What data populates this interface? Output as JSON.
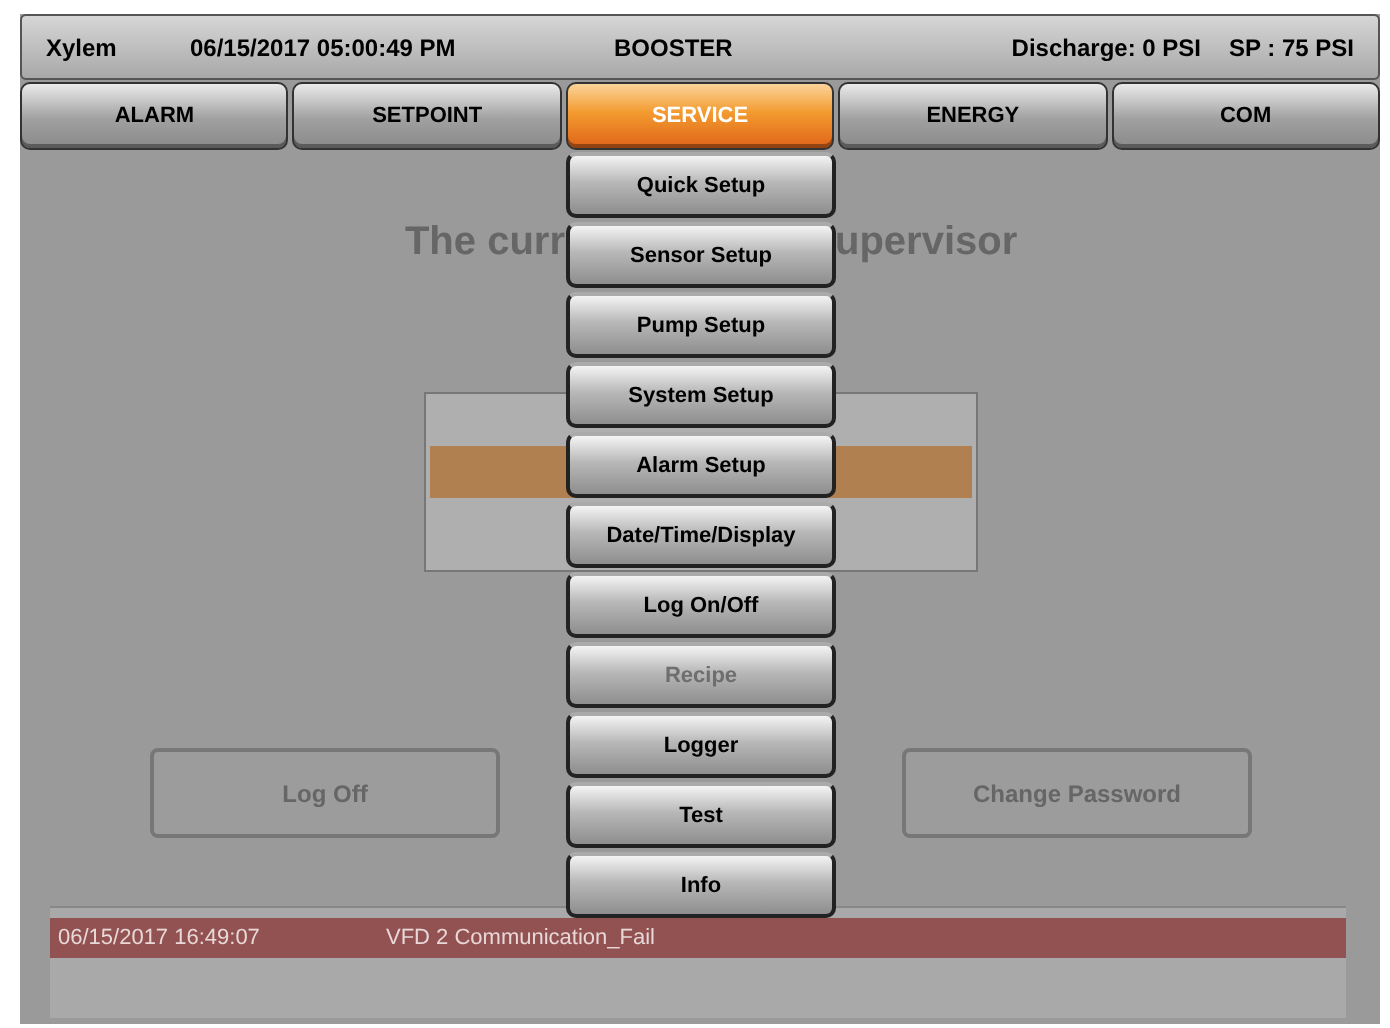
{
  "header": {
    "brand": "Xylem",
    "datetime": "06/15/2017 05:00:49 PM",
    "title": "BOOSTER",
    "discharge": "Discharge: 0 PSI",
    "setpoint": "SP : 75 PSI"
  },
  "tabs": [
    {
      "label": "ALARM",
      "selected": false
    },
    {
      "label": "SETPOINT",
      "selected": false
    },
    {
      "label": "SERVICE",
      "selected": true
    },
    {
      "label": "ENERGY",
      "selected": false
    },
    {
      "label": "COM",
      "selected": false
    }
  ],
  "heading": {
    "left": "The curr",
    "right": "upervisor"
  },
  "menu": [
    {
      "label": "Quick Setup",
      "disabled": false
    },
    {
      "label": "Sensor Setup",
      "disabled": false
    },
    {
      "label": "Pump Setup",
      "disabled": false
    },
    {
      "label": "System Setup",
      "disabled": false
    },
    {
      "label": "Alarm Setup",
      "disabled": false
    },
    {
      "label": "Date/Time/Display",
      "disabled": false
    },
    {
      "label": "Log On/Off",
      "disabled": false
    },
    {
      "label": "Recipe",
      "disabled": true
    },
    {
      "label": "Logger",
      "disabled": false
    },
    {
      "label": "Test",
      "disabled": false
    },
    {
      "label": "Info",
      "disabled": false
    }
  ],
  "buttons": [
    {
      "label": "Log Off"
    },
    {
      "label": "Change Password"
    }
  ],
  "alarms": [
    {
      "time": "06/15/2017 16:49:07",
      "message": "VFD 2 Communication_Fail"
    }
  ]
}
